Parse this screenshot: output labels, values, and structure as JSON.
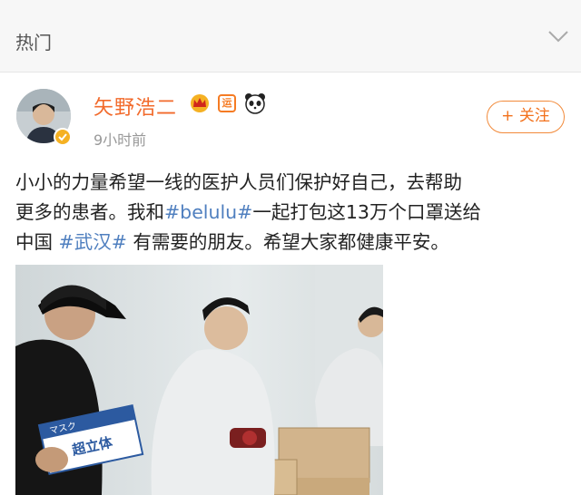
{
  "header": {
    "title": "热门"
  },
  "post": {
    "username": "矢野浩二",
    "badge_yun": "运",
    "timestamp": "9小时前",
    "follow_label": "+ 关注",
    "text_lines": [
      {
        "before": "小小的力量希望一线的医护人员们保护好自己，去帮助",
        "tag": "",
        "after": ""
      },
      {
        "before": "更多的患者。我和",
        "tag": "#belulu#",
        "after": "一起打包这13万个口罩送给"
      },
      {
        "before": "中国 ",
        "tag": "#武汉#",
        "after": " 有需要的朋友。希望大家都健康平安。"
      }
    ],
    "photo": {
      "box_text_top": "マスク",
      "box_text_main": "超立体"
    }
  },
  "colors": {
    "username": "#f26a2b",
    "hashtag": "#4f7fbf",
    "follow_border": "#f28a3a"
  }
}
